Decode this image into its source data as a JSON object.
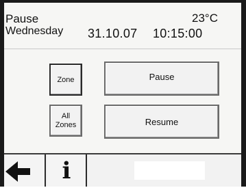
{
  "status": {
    "title": "Pause",
    "temperature": "23°C",
    "weekday": "Wednesday",
    "date": "31.10.07",
    "time": "10:15:00"
  },
  "buttons": {
    "zone": "Zone",
    "pause": "Pause",
    "all_zones_line1": "All",
    "all_zones_line2": "Zones",
    "resume": "Resume"
  },
  "footer": {
    "back_icon": "arrow-left-icon",
    "info_icon": "info-icon",
    "info_glyph": "i",
    "message": ""
  },
  "colors": {
    "screen_background": "#f6f6f4",
    "frame": "#1a1a1a",
    "button_face": "#f2f2f2"
  }
}
